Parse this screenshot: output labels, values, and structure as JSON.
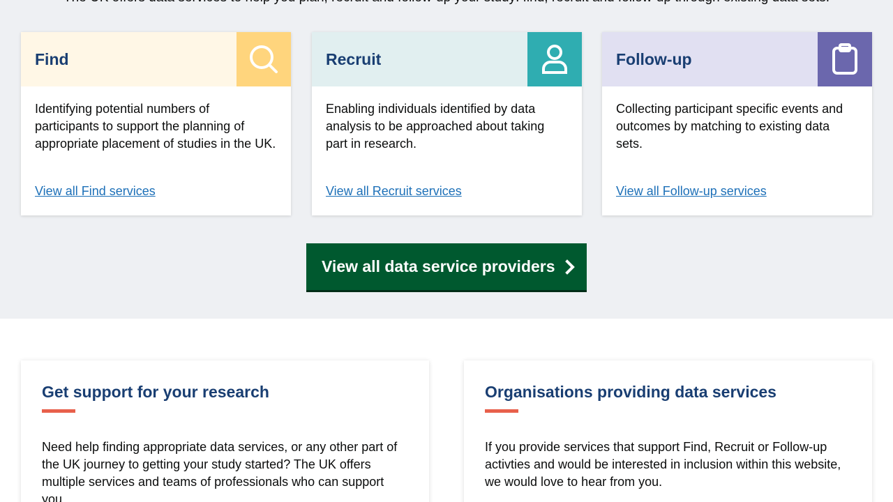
{
  "intro": {
    "text": "The UK offers data services to help you plan, recruit and follow-up your study: find, recruit and follow-up through existing data sets."
  },
  "cards": [
    {
      "title": "Find",
      "icon": "search-icon",
      "description": "Identifying potential numbers of participants to support the planning of appropriate placement of studies in the UK.",
      "link": "View all Find services"
    },
    {
      "title": "Recruit",
      "icon": "person-icon",
      "description": "Enabling individuals identified by data analysis to be approached about taking part in research.",
      "link": "View all Recruit services"
    },
    {
      "title": "Follow-up",
      "icon": "clipboard-icon",
      "description": "Collecting participant specific events and outcomes by matching to existing data sets.",
      "link": "View all Follow-up services"
    }
  ],
  "cta": {
    "label": "View all data service providers",
    "icon": "chevron-right-icon"
  },
  "panels": {
    "support": {
      "title": "Get support for your research",
      "text": "Need help finding appropriate data services, or any other part of the UK journey to getting your study started? The UK offers multiple services and teams of professionals who can support you."
    },
    "organisations": {
      "title": "Organisations providing data services",
      "text": "If you provide services that support Find, Recruit or Follow-up activties and would be interested in inclusion within this website, we would love to hear from you."
    }
  },
  "colors": {
    "heading": "#193e72",
    "link": "#1d70b8",
    "cta": "#00592f",
    "accent_bar": "#e8604b",
    "find_icon_bg": "#ffd57d",
    "recruit_icon_bg": "#2fadb1",
    "followup_icon_bg": "#6b67ad"
  }
}
